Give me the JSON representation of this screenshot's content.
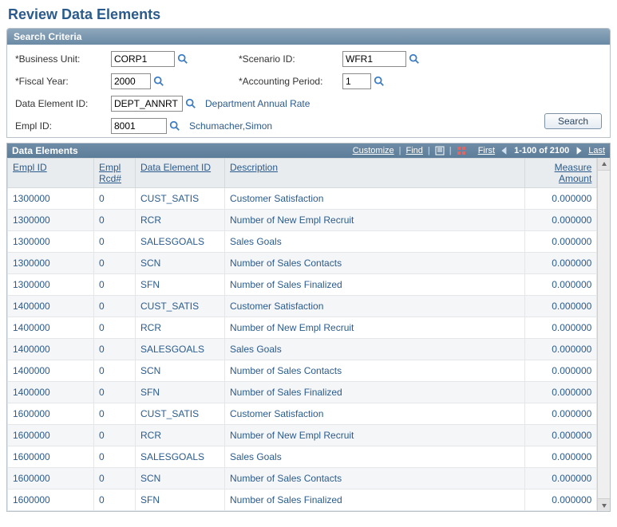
{
  "page": {
    "title": "Review Data Elements"
  },
  "search": {
    "panel_title": "Search Criteria",
    "labels": {
      "business_unit": "Business Unit:",
      "fiscal_year": "Fiscal Year:",
      "data_element_id": "Data Element ID:",
      "empl_id": "Empl ID:",
      "scenario_id": "Scenario ID:",
      "accounting_period": "Accounting Period:"
    },
    "values": {
      "business_unit": "CORP1",
      "fiscal_year": "2000",
      "data_element_id": "DEPT_ANNRT",
      "empl_id": "8001",
      "scenario_id": "WFR1",
      "accounting_period": "1"
    },
    "desc": {
      "data_element_id": "Department Annual Rate",
      "empl_id": "Schumacher,Simon"
    },
    "button": "Search"
  },
  "grid": {
    "title": "Data Elements",
    "nav": {
      "customize": "Customize",
      "find": "Find",
      "first": "First",
      "range": "1-100 of 2100",
      "last": "Last"
    },
    "columns": {
      "empl_id": "Empl ID",
      "empl_rcd": "Empl Rcd#",
      "data_element_id": "Data Element ID",
      "description": "Description",
      "measure_amount": "Measure Amount"
    },
    "rows": [
      {
        "empl_id": "1300000",
        "rcd": "0",
        "deid": "CUST_SATIS",
        "desc": "Customer Satisfaction",
        "amt": "0.000000"
      },
      {
        "empl_id": "1300000",
        "rcd": "0",
        "deid": "RCR",
        "desc": "Number of New Empl Recruit",
        "amt": "0.000000"
      },
      {
        "empl_id": "1300000",
        "rcd": "0",
        "deid": "SALESGOALS",
        "desc": "Sales Goals",
        "amt": "0.000000"
      },
      {
        "empl_id": "1300000",
        "rcd": "0",
        "deid": "SCN",
        "desc": "Number of Sales Contacts",
        "amt": "0.000000"
      },
      {
        "empl_id": "1300000",
        "rcd": "0",
        "deid": "SFN",
        "desc": "Number of Sales Finalized",
        "amt": "0.000000"
      },
      {
        "empl_id": "1400000",
        "rcd": "0",
        "deid": "CUST_SATIS",
        "desc": "Customer Satisfaction",
        "amt": "0.000000"
      },
      {
        "empl_id": "1400000",
        "rcd": "0",
        "deid": "RCR",
        "desc": "Number of New Empl Recruit",
        "amt": "0.000000"
      },
      {
        "empl_id": "1400000",
        "rcd": "0",
        "deid": "SALESGOALS",
        "desc": "Sales Goals",
        "amt": "0.000000"
      },
      {
        "empl_id": "1400000",
        "rcd": "0",
        "deid": "SCN",
        "desc": "Number of Sales Contacts",
        "amt": "0.000000"
      },
      {
        "empl_id": "1400000",
        "rcd": "0",
        "deid": "SFN",
        "desc": "Number of Sales Finalized",
        "amt": "0.000000"
      },
      {
        "empl_id": "1600000",
        "rcd": "0",
        "deid": "CUST_SATIS",
        "desc": "Customer Satisfaction",
        "amt": "0.000000"
      },
      {
        "empl_id": "1600000",
        "rcd": "0",
        "deid": "RCR",
        "desc": "Number of New Empl Recruit",
        "amt": "0.000000"
      },
      {
        "empl_id": "1600000",
        "rcd": "0",
        "deid": "SALESGOALS",
        "desc": "Sales Goals",
        "amt": "0.000000"
      },
      {
        "empl_id": "1600000",
        "rcd": "0",
        "deid": "SCN",
        "desc": "Number of Sales Contacts",
        "amt": "0.000000"
      },
      {
        "empl_id": "1600000",
        "rcd": "0",
        "deid": "SFN",
        "desc": "Number of Sales Finalized",
        "amt": "0.000000"
      }
    ]
  }
}
